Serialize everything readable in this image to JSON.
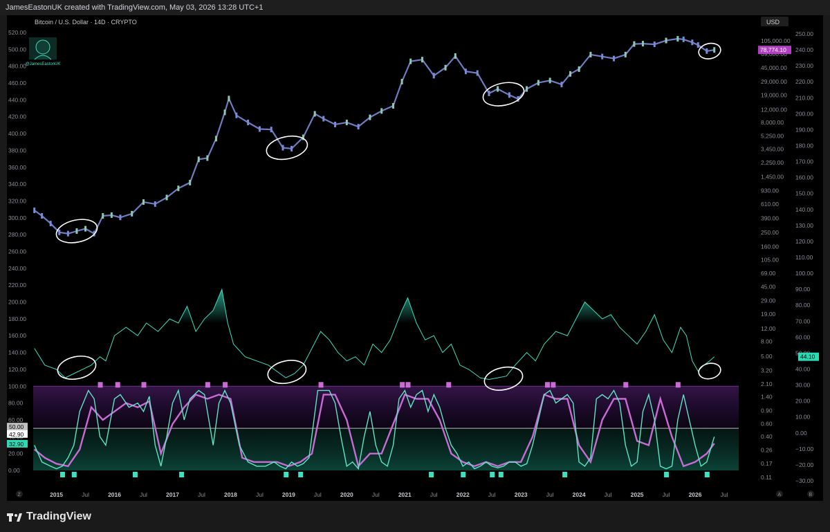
{
  "header": {
    "credit": "JamesEastonUK created with TradingView.com, May 03, 2026 13:28 UTC+1"
  },
  "footer": {
    "brand": "TradingView"
  },
  "colors": {
    "candle": "#7b8ad6",
    "candle_up": "#8ec8b3",
    "osc": "#3ee0bf",
    "stoch_k": "#5fe6c4",
    "stoch_d": "#c86bd4",
    "price_label": "#b040c0",
    "osc_label": "#2bd9b5"
  },
  "chart_data": {
    "type": "line",
    "title": "Bitcoin / U.S. Dollar · 14D · CRYPTO",
    "watermark": "@JamesEastonUK",
    "currency_button": "USD",
    "left_axis_ticks": [
      "520.00",
      "500.00",
      "480.00",
      "460.00",
      "440.00",
      "420.00",
      "400.00",
      "380.00",
      "360.00",
      "340.00",
      "320.00",
      "300.00",
      "280.00",
      "260.00",
      "240.00",
      "220.00",
      "200.00",
      "180.00",
      "160.00",
      "140.00",
      "120.00",
      "100.00",
      "80.00",
      "60.00",
      "40.00",
      "20.00",
      "0.00"
    ],
    "price_axis_ticks": [
      "105,000.00",
      "69,000.00",
      "45,000.00",
      "29,000.00",
      "19,000.00",
      "12,000.00",
      "8,000.00",
      "5,250.00",
      "3,450.00",
      "2,250.00",
      "1,450.00",
      "930.00",
      "610.00",
      "390.00",
      "250.00",
      "160.00",
      "105.00",
      "69.00",
      "45.00",
      "29.00",
      "19.00",
      "12.00",
      "8.00",
      "5.00",
      "3.20",
      "2.10",
      "1.40",
      "0.90",
      "0.60",
      "0.40",
      "0.26",
      "0.17",
      "0.11"
    ],
    "right_axis_ticks": [
      "250.00",
      "240.00",
      "230.00",
      "220.00",
      "210.00",
      "200.00",
      "190.00",
      "180.00",
      "170.00",
      "160.00",
      "150.00",
      "140.00",
      "130.00",
      "120.00",
      "110.00",
      "100.00",
      "90.00",
      "80.00",
      "70.00",
      "60.00",
      "50.00",
      "40.00",
      "30.00",
      "20.00",
      "10.00",
      "0.00",
      "−10.00",
      "−20.00",
      "−30.00"
    ],
    "x_ticks": [
      "2015",
      "Jul",
      "2016",
      "Jul",
      "2017",
      "Jul",
      "2018",
      "Jul",
      "2019",
      "Jul",
      "2020",
      "Jul",
      "2021",
      "Jul",
      "2022",
      "Jul",
      "2023",
      "Jul",
      "2024",
      "Jul",
      "2025",
      "Jul",
      "2026",
      "Jul"
    ],
    "x_range": [
      2014.6,
      2026.75
    ],
    "price_label": "78,774.10",
    "osc_label": "44.10",
    "stoch_labels": [
      "50.00",
      "42.90",
      "32.90"
    ],
    "price_series": {
      "scale": "log",
      "name": "BTCUSD",
      "x": [
        2014.62,
        2014.75,
        2014.9,
        2015.05,
        2015.2,
        2015.35,
        2015.5,
        2015.65,
        2015.8,
        2015.95,
        2016.1,
        2016.3,
        2016.5,
        2016.7,
        2016.9,
        2017.1,
        2017.3,
        2017.45,
        2017.6,
        2017.75,
        2017.9,
        2017.97,
        2018.1,
        2018.3,
        2018.5,
        2018.7,
        2018.9,
        2019.05,
        2019.25,
        2019.45,
        2019.6,
        2019.8,
        2020.0,
        2020.2,
        2020.4,
        2020.6,
        2020.8,
        2020.95,
        2021.1,
        2021.3,
        2021.5,
        2021.7,
        2021.87,
        2022.05,
        2022.25,
        2022.45,
        2022.6,
        2022.8,
        2022.95,
        2023.1,
        2023.3,
        2023.5,
        2023.7,
        2023.85,
        2024.0,
        2024.2,
        2024.4,
        2024.6,
        2024.8,
        2024.95,
        2025.1,
        2025.3,
        2025.5,
        2025.7,
        2025.8,
        2025.95,
        2026.05,
        2026.2,
        2026.33
      ],
      "values": [
        500,
        420,
        330,
        250,
        240,
        260,
        280,
        240,
        420,
        430,
        400,
        450,
        650,
        610,
        750,
        1000,
        1200,
        2500,
        2600,
        4800,
        11000,
        17000,
        10000,
        8000,
        6500,
        6400,
        3600,
        3500,
        5000,
        10500,
        9000,
        7500,
        8000,
        7000,
        9400,
        11500,
        13500,
        29000,
        55000,
        58000,
        35000,
        45000,
        65000,
        40000,
        38000,
        20000,
        23000,
        19000,
        16800,
        23000,
        28000,
        30000,
        26500,
        37000,
        43000,
        68000,
        64000,
        60000,
        68000,
        95000,
        96000,
        94000,
        106000,
        112000,
        110000,
        100000,
        92000,
        76000,
        78774
      ]
    },
    "oscillator_series": {
      "name": "oscillator",
      "x": [
        2014.62,
        2014.8,
        2015.0,
        2015.15,
        2015.3,
        2015.45,
        2015.6,
        2015.75,
        2015.85,
        2016.0,
        2016.2,
        2016.4,
        2016.55,
        2016.75,
        2016.95,
        2017.1,
        2017.25,
        2017.4,
        2017.55,
        2017.7,
        2017.85,
        2017.95,
        2018.05,
        2018.25,
        2018.45,
        2018.65,
        2018.85,
        2018.95,
        2019.1,
        2019.25,
        2019.4,
        2019.55,
        2019.7,
        2019.85,
        2020.0,
        2020.15,
        2020.3,
        2020.45,
        2020.6,
        2020.75,
        2020.95,
        2021.05,
        2021.2,
        2021.35,
        2021.5,
        2021.65,
        2021.8,
        2021.95,
        2022.1,
        2022.3,
        2022.45,
        2022.6,
        2022.75,
        2022.9,
        2023.1,
        2023.25,
        2023.4,
        2023.6,
        2023.8,
        2023.95,
        2024.1,
        2024.25,
        2024.4,
        2024.55,
        2024.7,
        2024.85,
        2025.0,
        2025.15,
        2025.3,
        2025.45,
        2025.6,
        2025.75,
        2025.85,
        2025.95,
        2026.05,
        2026.15,
        2026.25,
        2026.33
      ],
      "values": [
        145,
        125,
        120,
        110,
        115,
        120,
        125,
        135,
        130,
        160,
        170,
        160,
        175,
        165,
        180,
        175,
        195,
        165,
        180,
        190,
        215,
        175,
        150,
        135,
        130,
        125,
        115,
        110,
        115,
        125,
        145,
        165,
        155,
        140,
        130,
        135,
        125,
        150,
        140,
        155,
        190,
        205,
        175,
        155,
        160,
        140,
        150,
        125,
        120,
        110,
        108,
        110,
        112,
        125,
        140,
        130,
        150,
        165,
        160,
        180,
        200,
        190,
        180,
        185,
        170,
        160,
        150,
        165,
        185,
        155,
        140,
        170,
        160,
        130,
        118,
        125,
        130,
        135
      ]
    },
    "stoch_k": {
      "name": "%K",
      "x": [
        2014.62,
        2014.75,
        2014.9,
        2015.0,
        2015.1,
        2015.2,
        2015.3,
        2015.4,
        2015.55,
        2015.65,
        2015.75,
        2015.85,
        2016.0,
        2016.1,
        2016.25,
        2016.4,
        2016.5,
        2016.6,
        2016.7,
        2016.8,
        2016.9,
        2017.0,
        2017.1,
        2017.2,
        2017.3,
        2017.45,
        2017.55,
        2017.7,
        2017.8,
        2017.9,
        2018.0,
        2018.15,
        2018.3,
        2018.45,
        2018.6,
        2018.75,
        2018.85,
        2018.95,
        2019.05,
        2019.15,
        2019.25,
        2019.35,
        2019.5,
        2019.6,
        2019.7,
        2019.8,
        2019.9,
        2020.0,
        2020.1,
        2020.2,
        2020.3,
        2020.4,
        2020.5,
        2020.6,
        2020.7,
        2020.8,
        2020.9,
        2021.0,
        2021.1,
        2021.2,
        2021.3,
        2021.4,
        2021.5,
        2021.6,
        2021.7,
        2021.8,
        2021.9,
        2022.0,
        2022.1,
        2022.2,
        2022.3,
        2022.4,
        2022.5,
        2022.6,
        2022.7,
        2022.8,
        2022.9,
        2023.0,
        2023.1,
        2023.2,
        2023.3,
        2023.4,
        2023.5,
        2023.6,
        2023.7,
        2023.8,
        2023.9,
        2024.0,
        2024.1,
        2024.2,
        2024.3,
        2024.4,
        2024.5,
        2024.6,
        2024.7,
        2024.8,
        2024.9,
        2025.0,
        2025.1,
        2025.2,
        2025.3,
        2025.4,
        2025.5,
        2025.6,
        2025.7,
        2025.8,
        2025.9,
        2026.0,
        2026.1,
        2026.2,
        2026.33
      ],
      "values": [
        30,
        10,
        5,
        2,
        5,
        15,
        30,
        70,
        95,
        85,
        40,
        30,
        85,
        90,
        75,
        80,
        70,
        88,
        30,
        5,
        40,
        80,
        95,
        60,
        85,
        95,
        90,
        30,
        80,
        95,
        80,
        30,
        10,
        5,
        5,
        10,
        5,
        2,
        10,
        5,
        8,
        15,
        95,
        95,
        95,
        80,
        40,
        5,
        10,
        2,
        40,
        70,
        30,
        10,
        5,
        30,
        85,
        95,
        75,
        90,
        95,
        70,
        90,
        75,
        50,
        30,
        20,
        5,
        10,
        2,
        5,
        10,
        5,
        3,
        5,
        10,
        10,
        5,
        8,
        30,
        60,
        90,
        95,
        80,
        85,
        90,
        80,
        10,
        5,
        15,
        85,
        90,
        85,
        95,
        80,
        30,
        5,
        10,
        70,
        90,
        60,
        5,
        2,
        5,
        60,
        90,
        60,
        30,
        5,
        10,
        40
      ]
    },
    "stoch_d": {
      "name": "%D",
      "x": [
        2014.62,
        2014.8,
        2015.0,
        2015.2,
        2015.4,
        2015.6,
        2015.8,
        2016.0,
        2016.2,
        2016.4,
        2016.6,
        2016.8,
        2017.0,
        2017.2,
        2017.4,
        2017.6,
        2017.8,
        2018.0,
        2018.2,
        2018.4,
        2018.6,
        2018.8,
        2019.0,
        2019.2,
        2019.4,
        2019.6,
        2019.8,
        2020.0,
        2020.2,
        2020.4,
        2020.6,
        2020.8,
        2021.0,
        2021.2,
        2021.4,
        2021.6,
        2021.8,
        2022.0,
        2022.2,
        2022.4,
        2022.6,
        2022.8,
        2023.0,
        2023.2,
        2023.4,
        2023.6,
        2023.8,
        2024.0,
        2024.2,
        2024.4,
        2024.6,
        2024.8,
        2025.0,
        2025.2,
        2025.4,
        2025.6,
        2025.8,
        2026.0,
        2026.2,
        2026.33
      ],
      "values": [
        25,
        15,
        8,
        5,
        25,
        75,
        60,
        70,
        80,
        75,
        82,
        20,
        55,
        75,
        90,
        85,
        90,
        85,
        15,
        10,
        10,
        10,
        5,
        10,
        20,
        90,
        90,
        60,
        5,
        20,
        20,
        55,
        90,
        85,
        85,
        60,
        20,
        10,
        5,
        10,
        5,
        10,
        10,
        40,
        90,
        85,
        85,
        30,
        10,
        60,
        85,
        85,
        35,
        30,
        85,
        40,
        5,
        10,
        20,
        32
      ]
    }
  }
}
